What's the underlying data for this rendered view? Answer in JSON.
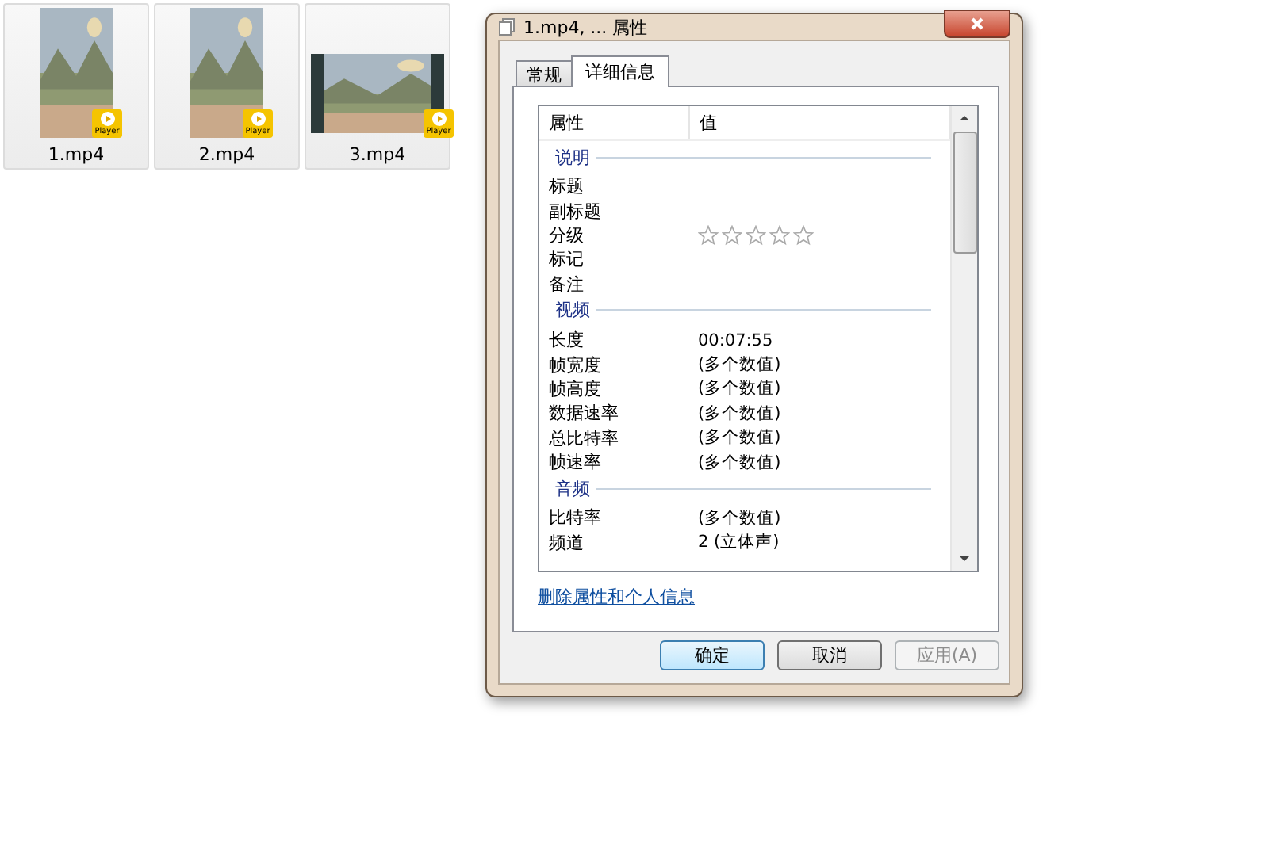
{
  "files": [
    {
      "name": "1.mp4",
      "kind": "picture",
      "badge": "Player",
      "filmstrip": false
    },
    {
      "name": "2.mp4",
      "kind": "picture",
      "badge": "Player",
      "filmstrip": false
    },
    {
      "name": "3.mp4",
      "kind": "picture",
      "badge": "Player",
      "filmstrip": true
    }
  ],
  "dialog": {
    "title": "1.mp4, ... 属性",
    "tabs": [
      {
        "label": "常规",
        "selected": false
      },
      {
        "label": "详细信息",
        "selected": true
      }
    ],
    "columns": [
      "属性",
      "值"
    ],
    "rows": [
      {
        "kind": "group",
        "label": "说明"
      },
      {
        "kind": "property",
        "label": "标题"
      },
      {
        "kind": "property",
        "label": "副标题"
      },
      {
        "kind": "rating",
        "label": "分级",
        "stars": 0
      },
      {
        "kind": "property",
        "label": "标记"
      },
      {
        "kind": "property",
        "label": "备注"
      },
      {
        "kind": "group",
        "label": "视频"
      },
      {
        "kind": "property",
        "label": "长度",
        "value": "00:07:55"
      },
      {
        "kind": "property",
        "label": "帧宽度",
        "value": "(多个数值)"
      },
      {
        "kind": "property",
        "label": "帧高度",
        "value": "(多个数值)"
      },
      {
        "kind": "property",
        "label": "数据速率",
        "value": "(多个数值)"
      },
      {
        "kind": "property",
        "label": "总比特率",
        "value": "(多个数值)"
      },
      {
        "kind": "property",
        "label": "帧速率",
        "value": "(多个数值)"
      },
      {
        "kind": "group",
        "label": "音频"
      },
      {
        "kind": "property",
        "label": "比特率",
        "value": "(多个数值)"
      },
      {
        "kind": "property",
        "label": "频道",
        "value": "2 (立体声)"
      }
    ],
    "link": "删除属性和个人信息",
    "buttons": [
      {
        "label": "确定",
        "default": true,
        "disabled": false
      },
      {
        "label": "取消",
        "default": false,
        "disabled": false
      },
      {
        "label": "应用(A)",
        "default": false,
        "disabled": true
      }
    ]
  }
}
